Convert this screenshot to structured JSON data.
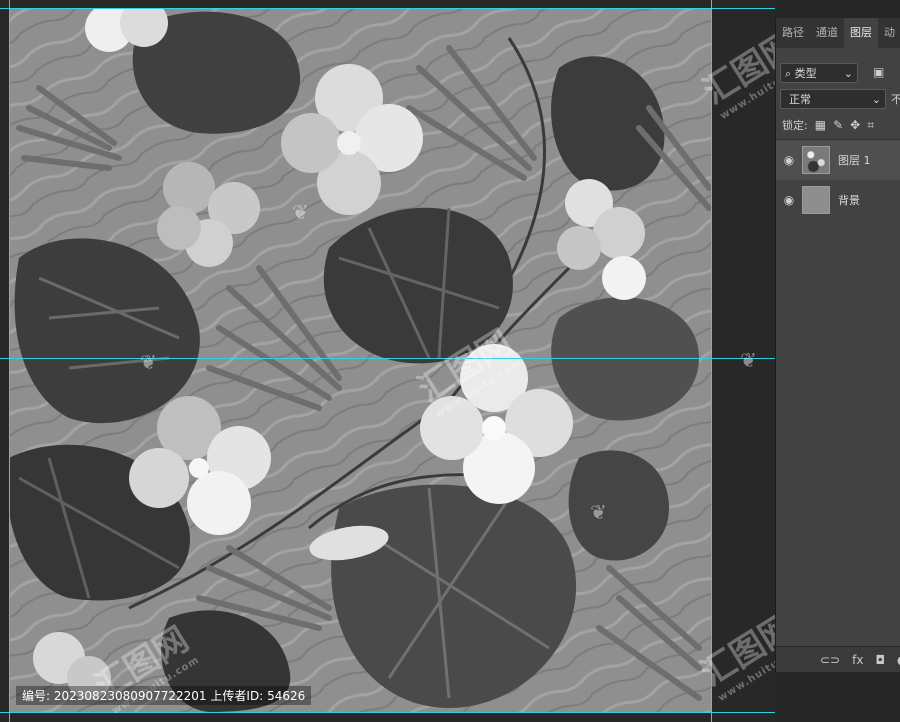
{
  "panel": {
    "tabs": [
      {
        "label": "路径"
      },
      {
        "label": "通道"
      },
      {
        "label": "图层"
      },
      {
        "label": "动"
      }
    ],
    "filter_kind": "类型",
    "blend_mode": "正常",
    "opacity_label_partial": "不",
    "lock_label": "锁定:",
    "layers": [
      {
        "name": "图层 1"
      },
      {
        "name": "背景"
      }
    ],
    "footer": {
      "link": "⊂⊃",
      "fx": "fx",
      "mask": "◘",
      "adjust": "◐"
    }
  },
  "info_bar": {
    "id_label": "编号:",
    "id_value": "20230823080907722201",
    "uploader_label": "上传者ID:",
    "uploader_value": "54626"
  },
  "watermark": {
    "logo": "汇图网",
    "url": "www.huitu.com"
  },
  "colors": {
    "canvas_bg": "#8f8f8f",
    "guide": "#32d0e6",
    "panel_bg": "#424242"
  },
  "icons": {
    "eye": "eye-icon",
    "search": "search-icon",
    "lock": "lock-icon"
  }
}
